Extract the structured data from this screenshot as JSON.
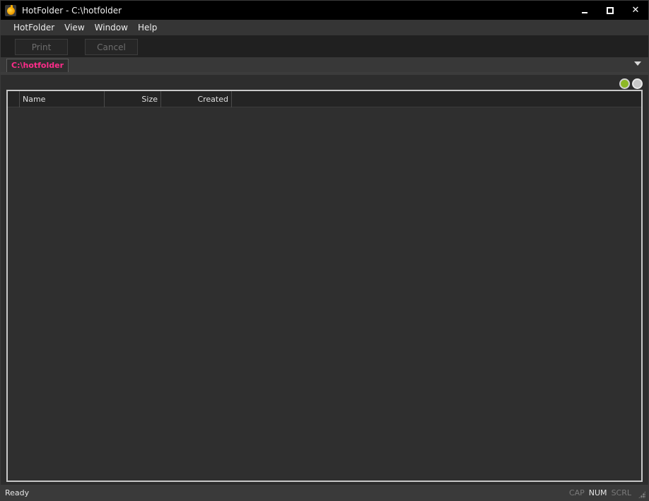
{
  "window": {
    "title": "HotFolder - C:\\hotfolder",
    "controls": {
      "minimize": "minimize",
      "maximize": "maximize",
      "close": "✕"
    }
  },
  "menu": {
    "items": [
      "HotFolder",
      "View",
      "Window",
      "Help"
    ]
  },
  "toolbar": {
    "print_label": "Print",
    "cancel_label": "Cancel"
  },
  "tabs": {
    "active_label": "C:\\hotfolder",
    "active_color": "#ff2c8a"
  },
  "indicators_top": {
    "left_color": "#8db825",
    "right_color": "#c8c8c8"
  },
  "list": {
    "columns": {
      "check": "",
      "name": "Name",
      "size": "Size",
      "created": "Created"
    },
    "rows": []
  },
  "status": {
    "text": "Ready",
    "caps": "CAP",
    "num": "NUM",
    "scroll": "SCRL"
  },
  "icons": {
    "app": "hotfolder-flame-icon",
    "dropdown": "triangle-down-icon",
    "grip": "resize-grip-icon"
  }
}
